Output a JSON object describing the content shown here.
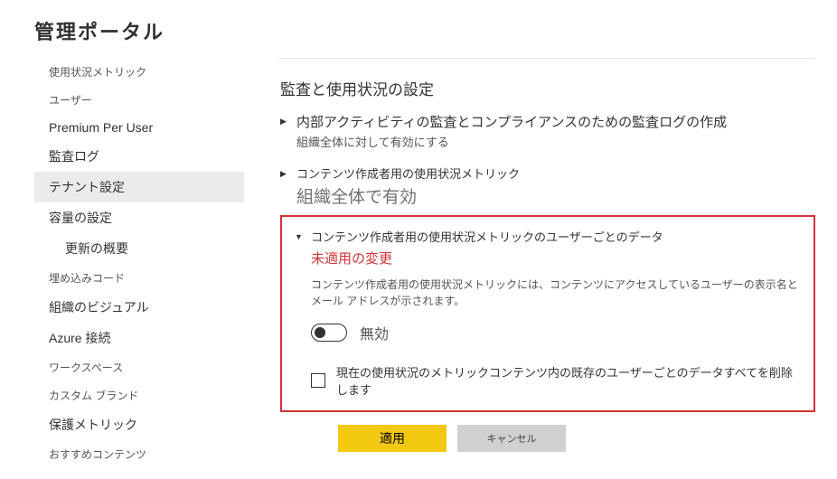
{
  "pageTitle": "管理ポータル",
  "sidebar": {
    "items": [
      {
        "label": "使用状況メトリック",
        "small": true
      },
      {
        "label": "ユーザー",
        "small": true
      },
      {
        "label": "Premium Per User",
        "small": false
      },
      {
        "label": "監査ログ",
        "small": false
      },
      {
        "label": "テナント設定",
        "small": false,
        "selected": true
      },
      {
        "label": "容量の設定",
        "small": false
      },
      {
        "label": "更新の概要",
        "small": false,
        "sub": true
      },
      {
        "label": "埋め込みコード",
        "small": true
      },
      {
        "label": "組織のビジュアル",
        "small": false
      },
      {
        "label": "Azure 接続",
        "small": false
      },
      {
        "label": "ワークスペース",
        "small": true
      },
      {
        "label": "カスタム ブランド",
        "small": true
      },
      {
        "label": "保護メトリック",
        "small": false
      },
      {
        "label": "おすすめコンテンツ",
        "small": true
      }
    ]
  },
  "main": {
    "sectionTitle": "監査と使用状況の設定",
    "setting1": {
      "heading": "内部アクティビティの監査とコンプライアンスのための監査ログの作成",
      "sub": "組織全体に対して有効にする"
    },
    "setting2": {
      "heading": "コンテンツ作成者用の使用状況メトリック",
      "orgEnabled": "組織全体で有効"
    },
    "setting3": {
      "heading": "コンテンツ作成者用の使用状況メトリックのユーザーごとのデータ",
      "warning": "未適用の変更",
      "desc": "コンテンツ作成者用の使用状況メトリックには、コンテンツにアクセスしているユーザーの表示名とメール アドレスが示されます。",
      "toggleLabel": "無効",
      "checkboxLabel": "現在の使用状況のメトリックコンテンツ内の既存のユーザーごとのデータすべてを削除します"
    },
    "buttons": {
      "apply": "適用",
      "cancel": "キャンセル"
    }
  }
}
